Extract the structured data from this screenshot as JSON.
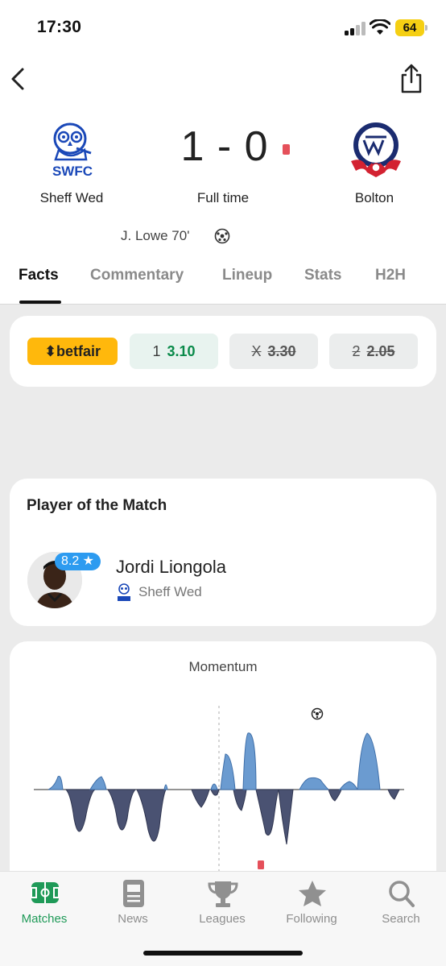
{
  "status_bar": {
    "time": "17:30",
    "battery": "64"
  },
  "header": {
    "back_icon": "chevron-left-icon",
    "share_icon": "share-icon"
  },
  "match": {
    "home_team": "Sheff Wed",
    "home_crest_text": "SWFC",
    "away_team": "Bolton",
    "score": "1 - 0",
    "status": "Full time",
    "scorer": "J.  Lowe 70'",
    "red_card_color": "#e5505a"
  },
  "tabs": [
    {
      "label": "Facts",
      "active": true
    },
    {
      "label": "Commentary",
      "active": false
    },
    {
      "label": "Lineup",
      "active": false
    },
    {
      "label": "Stats",
      "active": false
    },
    {
      "label": "H2H",
      "active": false
    }
  ],
  "odds": {
    "brand": "betfair",
    "brand_color": "#ffb80c",
    "items": [
      {
        "label": "1",
        "value": "3.10",
        "settled": false
      },
      {
        "label": "X",
        "value": "3.30",
        "settled": true
      },
      {
        "label": "2",
        "value": "2.05",
        "settled": true
      }
    ]
  },
  "player_of_match": {
    "title": "Player of the Match",
    "rating": "8.2",
    "name": "Jordi Liongola",
    "team": "Sheff Wed"
  },
  "momentum": {
    "title": "Momentum",
    "home_color": "#6b9bd0",
    "away_color": "#4a5272"
  },
  "bottom_nav": [
    {
      "label": "Matches",
      "icon": "pitch-icon",
      "active": true
    },
    {
      "label": "News",
      "icon": "news-icon",
      "active": false
    },
    {
      "label": "Leagues",
      "icon": "trophy-icon",
      "active": false
    },
    {
      "label": "Following",
      "icon": "star-icon",
      "active": false
    },
    {
      "label": "Search",
      "icon": "search-icon",
      "active": false
    }
  ]
}
